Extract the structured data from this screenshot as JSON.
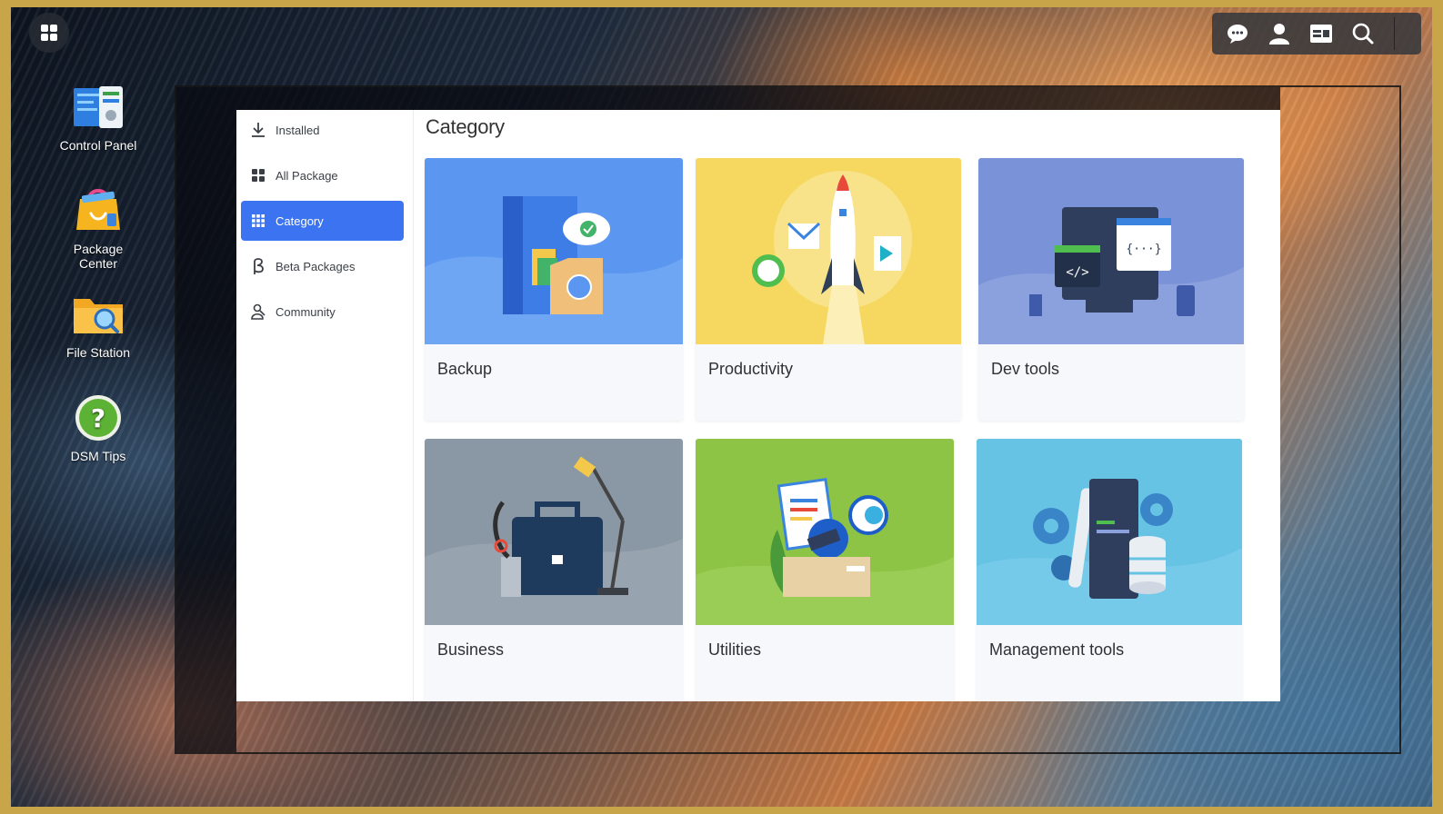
{
  "desktop": {
    "icons": [
      {
        "label": "Control Panel"
      },
      {
        "label": "Package Center"
      },
      {
        "label": "File Station"
      },
      {
        "label": "DSM Tips"
      }
    ]
  },
  "taskbar": {
    "main_menu_icon": "grid-icon",
    "tray_icons": [
      "chat-icon",
      "user-icon",
      "widgets-icon",
      "search-icon"
    ]
  },
  "sidebar": {
    "items": [
      {
        "label": "Installed",
        "icon": "download-icon",
        "active": false
      },
      {
        "label": "All Package",
        "icon": "grid-icon",
        "active": false
      },
      {
        "label": "Category",
        "icon": "category-grid-icon",
        "active": true
      },
      {
        "label": "Beta Packages",
        "icon": "beta-icon",
        "active": false
      },
      {
        "label": "Community",
        "icon": "community-icon",
        "active": false
      }
    ]
  },
  "main": {
    "title": "Category",
    "categories": [
      {
        "label": "Backup",
        "color": "#5b97f0"
      },
      {
        "label": "Productivity",
        "color": "#f6d860"
      },
      {
        "label": "Dev tools",
        "color": "#7a93d8"
      },
      {
        "label": "Business",
        "color": "#8a97a4"
      },
      {
        "label": "Utilities",
        "color": "#8ec445"
      },
      {
        "label": "Management tools",
        "color": "#66c3e4"
      }
    ]
  },
  "colors": {
    "accent": "#3c73f0",
    "frame_gold": "#c9a54a"
  }
}
